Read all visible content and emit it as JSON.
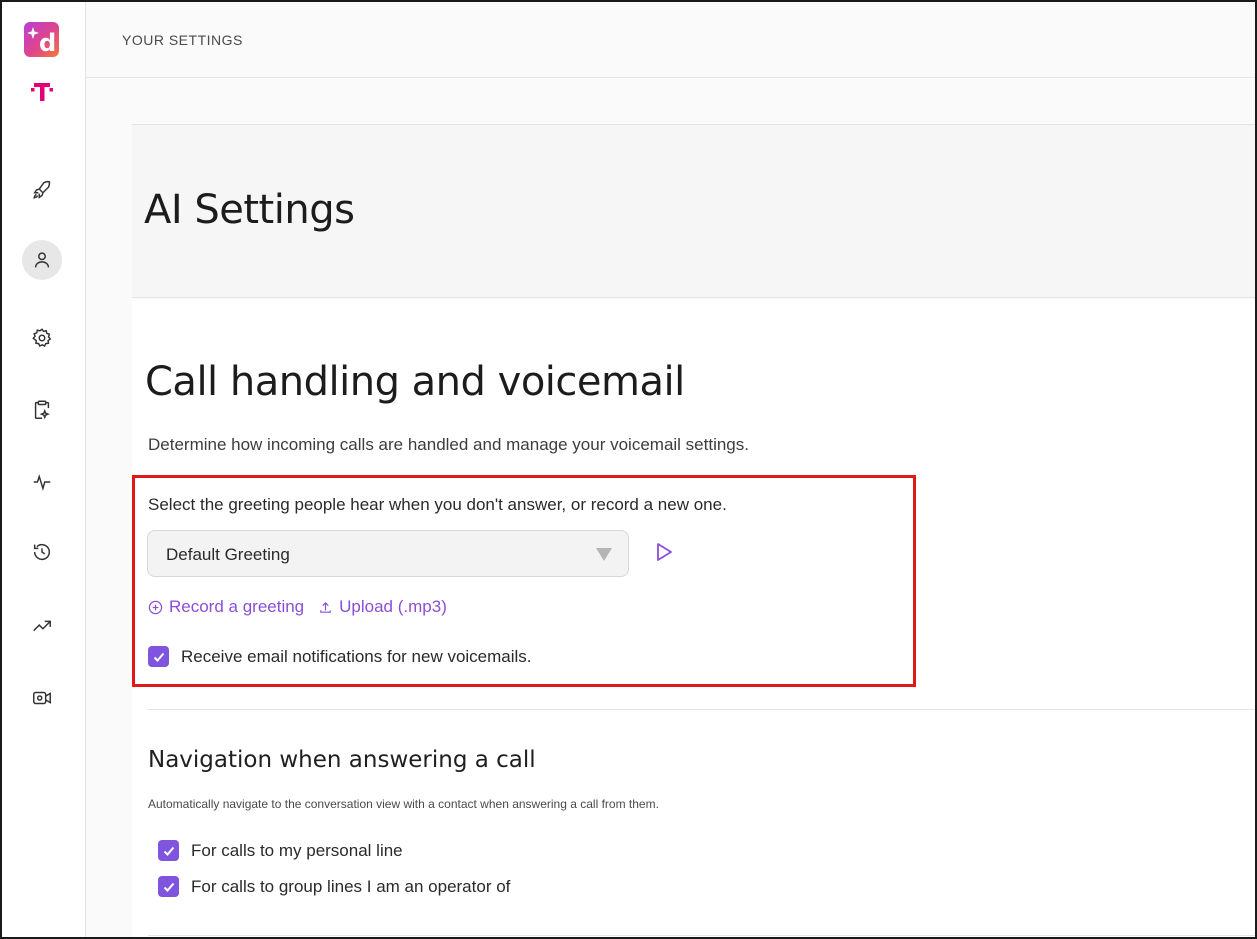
{
  "header": {
    "title": "YOUR SETTINGS"
  },
  "sidebar": {
    "logo_letter": "d",
    "items": [
      {
        "name": "launch",
        "icon": "rocket-icon"
      },
      {
        "name": "profile",
        "icon": "person-icon",
        "active": true
      },
      {
        "name": "settings",
        "icon": "gear-icon"
      },
      {
        "name": "ai-tasks",
        "icon": "clipboard-sparkle-icon"
      },
      {
        "name": "activity",
        "icon": "pulse-icon"
      },
      {
        "name": "history",
        "icon": "history-icon"
      },
      {
        "name": "analytics",
        "icon": "trending-up-icon"
      },
      {
        "name": "video-settings",
        "icon": "video-gear-icon"
      }
    ]
  },
  "main": {
    "page_title": "AI Settings",
    "section_title": "Call handling and voicemail",
    "section_desc": "Determine how incoming calls are handled and manage your voicemail settings.",
    "greeting": {
      "prompt": "Select the greeting people hear when you don't answer, or record a new one.",
      "selected": "Default Greeting",
      "record_label": "Record a greeting",
      "upload_label": "Upload (.mp3)",
      "email_notify_label": "Receive email notifications for new voicemails.",
      "email_notify_checked": true
    },
    "navigation": {
      "title": "Navigation when answering a call",
      "desc": "Automatically navigate to the conversation view with a contact when answering a call from them.",
      "options": [
        {
          "label": "For calls to my personal line",
          "checked": true
        },
        {
          "label": "For calls to group lines I am an operator of",
          "checked": true
        }
      ]
    }
  },
  "colors": {
    "accent": "#7f55e0",
    "link": "#8a4fd6",
    "highlight": "#e01818",
    "brand_magenta": "#e20074"
  }
}
